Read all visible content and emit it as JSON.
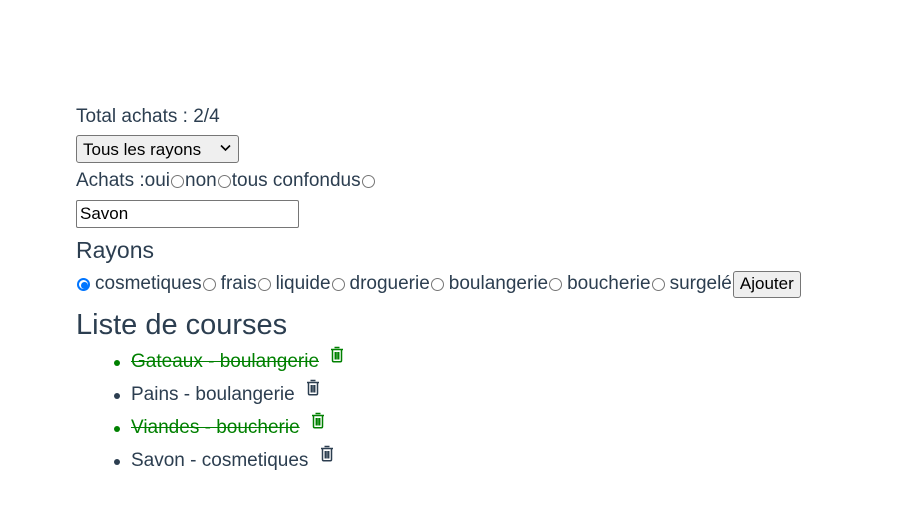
{
  "total": {
    "label": "Total achats : 2/4"
  },
  "filter": {
    "selected": "Tous les rayons"
  },
  "achats": {
    "label": "Achats :",
    "options": [
      "oui",
      "non",
      "tous confondus"
    ]
  },
  "new_item": {
    "value": "Savon"
  },
  "rayons": {
    "title": "Rayons",
    "options": [
      "cosmetiques",
      "frais",
      "liquide",
      "droguerie",
      "boulangerie",
      "boucherie",
      "surgelé"
    ],
    "selected": "cosmetiques",
    "add_label": "Ajouter"
  },
  "list": {
    "title": "Liste de courses",
    "items": [
      {
        "text": "Gateaux - boulangerie",
        "done": true
      },
      {
        "text": "Pains - boulangerie",
        "done": false
      },
      {
        "text": "Viandes - boucherie",
        "done": true
      },
      {
        "text": "Savon - cosmetiques",
        "done": false
      }
    ]
  },
  "colors": {
    "done": "#008000",
    "text": "#2c3e50",
    "accent": "#0075ff"
  },
  "icons": {
    "delete": "trash-icon",
    "dropdown": "chevron-down-icon"
  }
}
